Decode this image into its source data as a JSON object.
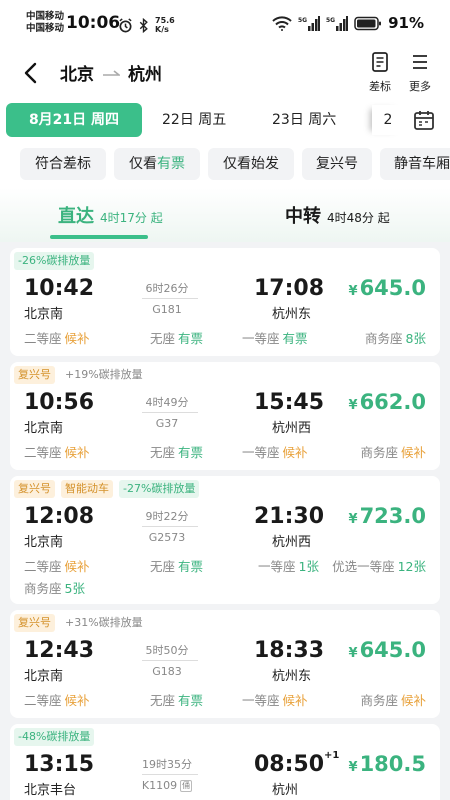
{
  "status_bar": {
    "carrier_1": "中国移动",
    "carrier_2": "中国移动",
    "time": "10:06",
    "speed_value": "75.6",
    "speed_unit": "K/s",
    "battery": "91%"
  },
  "header": {
    "from": "北京",
    "to": "杭州",
    "filter_label": "差标",
    "more_label": "更多"
  },
  "dates": [
    {
      "label": "8月21日 周四",
      "active": true
    },
    {
      "label": "22日 周五",
      "active": false
    },
    {
      "label": "23日 周六",
      "active": false
    },
    {
      "label": "2",
      "active": false
    }
  ],
  "filters": [
    {
      "pre": "符合差标",
      "hl": ""
    },
    {
      "pre": "仅看",
      "hl": "有票"
    },
    {
      "pre": "仅看始发",
      "hl": ""
    },
    {
      "pre": "复兴号",
      "hl": ""
    },
    {
      "pre": "静音车厢",
      "hl": ""
    }
  ],
  "tabs": {
    "direct": {
      "label": "直达",
      "sub": "4时17分 起"
    },
    "transfer": {
      "label": "中转",
      "sub": "4时48分 起"
    }
  },
  "trains": [
    {
      "tags": [
        {
          "text": "-26%碳排放量",
          "kind": "carbon"
        }
      ],
      "dep_time": "10:42",
      "dep_station": "北京南",
      "duration": "6时26分",
      "train_no": "G181",
      "arr_time": "17:08",
      "arr_plus": "",
      "arr_station": "杭州东",
      "price": "645.0",
      "seats": [
        {
          "name": "二等座",
          "value": "候补",
          "status": "wait"
        },
        {
          "name": "无座",
          "value": "有票",
          "status": "avail"
        },
        {
          "name": "一等座",
          "value": "有票",
          "status": "avail"
        },
        {
          "name": "商务座",
          "value": "8张",
          "status": "avail"
        }
      ]
    },
    {
      "tags": [
        {
          "text": "复兴号",
          "kind": "fx"
        },
        {
          "text": "+19%碳排放量",
          "kind": "plain"
        }
      ],
      "dep_time": "10:56",
      "dep_station": "北京南",
      "duration": "4时49分",
      "train_no": "G37",
      "arr_time": "15:45",
      "arr_plus": "",
      "arr_station": "杭州西",
      "price": "662.0",
      "seats": [
        {
          "name": "二等座",
          "value": "候补",
          "status": "wait"
        },
        {
          "name": "无座",
          "value": "有票",
          "status": "avail"
        },
        {
          "name": "一等座",
          "value": "候补",
          "status": "wait"
        },
        {
          "name": "商务座",
          "value": "候补",
          "status": "wait"
        }
      ]
    },
    {
      "tags": [
        {
          "text": "复兴号",
          "kind": "fx"
        },
        {
          "text": "智能动车",
          "kind": "smart"
        },
        {
          "text": "-27%碳排放量",
          "kind": "carbon"
        }
      ],
      "dep_time": "12:08",
      "dep_station": "北京南",
      "duration": "9时22分",
      "train_no": "G2573",
      "arr_time": "21:30",
      "arr_plus": "",
      "arr_station": "杭州西",
      "price": "723.0",
      "seats": [
        {
          "name": "二等座",
          "value": "候补",
          "status": "wait"
        },
        {
          "name": "无座",
          "value": "有票",
          "status": "avail"
        },
        {
          "name": "一等座",
          "value": "1张",
          "status": "avail"
        },
        {
          "name": "优选一等座",
          "value": "12张",
          "status": "avail"
        },
        {
          "name": "商务座",
          "value": "5张",
          "status": "avail"
        }
      ]
    },
    {
      "tags": [
        {
          "text": "复兴号",
          "kind": "fx"
        },
        {
          "text": "+31%碳排放量",
          "kind": "plain"
        }
      ],
      "dep_time": "12:43",
      "dep_station": "北京南",
      "duration": "5时50分",
      "train_no": "G183",
      "arr_time": "18:33",
      "arr_plus": "",
      "arr_station": "杭州东",
      "price": "645.0",
      "seats": [
        {
          "name": "二等座",
          "value": "候补",
          "status": "wait"
        },
        {
          "name": "无座",
          "value": "有票",
          "status": "avail"
        },
        {
          "name": "一等座",
          "value": "候补",
          "status": "wait"
        },
        {
          "name": "商务座",
          "value": "候补",
          "status": "wait"
        }
      ]
    },
    {
      "tags": [
        {
          "text": "-48%碳排放量",
          "kind": "carbon"
        }
      ],
      "dep_time": "13:15",
      "dep_station": "北京丰台",
      "duration": "19时35分",
      "train_no": "K1109",
      "train_badge": "俑",
      "arr_time": "08:50",
      "arr_plus": "+1",
      "arr_station": "杭州",
      "price": "180.5",
      "seats": []
    }
  ]
}
